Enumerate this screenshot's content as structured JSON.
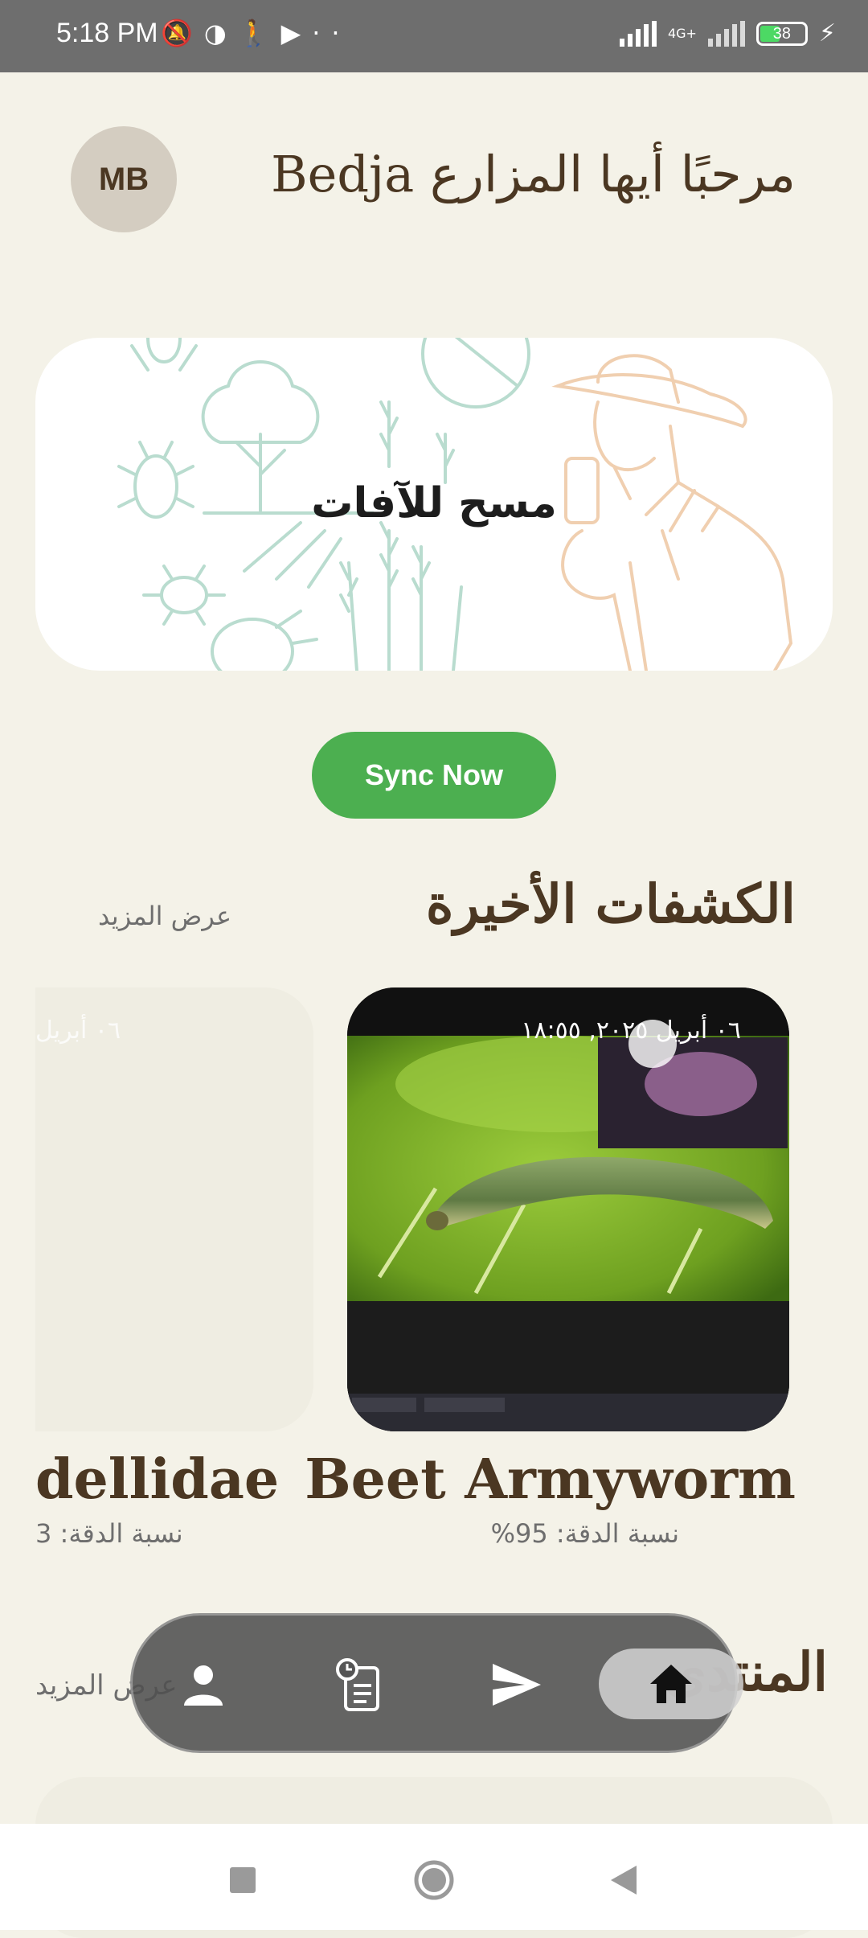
{
  "status_bar": {
    "time": "5:18 PM",
    "network_label": "4G+",
    "battery": "38"
  },
  "header": {
    "avatar_initials": "MB",
    "greeting": "مرحبًا أيها المزارع Bedja"
  },
  "scan_banner": {
    "title": "مسح للآفات"
  },
  "sync_button": "Sync Now",
  "recent_detections": {
    "title": "الكشفات الأخيرة",
    "see_more": "عرض المزيد",
    "items": [
      {
        "name": "Beet Armyworm",
        "date": "٠٦ أبريل ٢٠٢٥, ١٨:٥٥",
        "accuracy": "نسبة الدقة: 95%"
      },
      {
        "name": "dellidae",
        "date": "٠٦ أبريل",
        "accuracy": "نسبة الدقة: 3"
      }
    ]
  },
  "forum": {
    "title": "المنتدى",
    "see_more": "عرض المزيد"
  },
  "bottom_nav": {
    "items": [
      {
        "icon": "person-icon"
      },
      {
        "icon": "history-clipboard-icon"
      },
      {
        "icon": "send-icon"
      },
      {
        "icon": "home-icon",
        "active": true
      }
    ]
  },
  "colors": {
    "background": "#f4f2e8",
    "brown_text": "#4b3722",
    "sync_green": "#4caf50"
  }
}
